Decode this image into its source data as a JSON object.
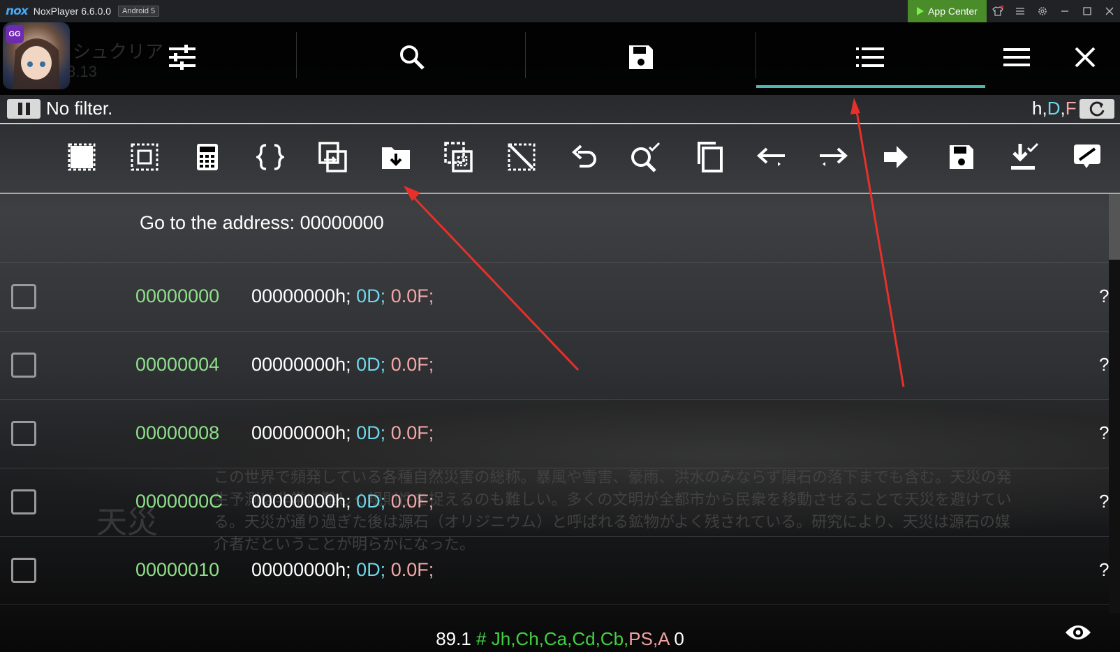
{
  "titlebar": {
    "logo": "nox",
    "title": "NoxPlayer 6.6.0.0",
    "android_badge": "Android 5",
    "app_center": "App Center",
    "icons": [
      "shirt-icon",
      "menu-icon",
      "gear-icon",
      "minimize-icon",
      "maximize-icon",
      "close-icon"
    ]
  },
  "gg_toolbar": {
    "avatar_badge": "GG",
    "ghost_title": "シュクリア",
    "ghost_version": "8.13",
    "tabs": [
      "settings-sliders-icon",
      "search-icon",
      "save-icon",
      "list-icon"
    ],
    "active_tab": "list-icon",
    "right_icons": [
      "hamburger-icon",
      "close-icon"
    ],
    "accent": "#4fb6b0"
  },
  "filter": {
    "text": "No filter.",
    "type_h": "h",
    "sep1": ",",
    "type_d": "D",
    "sep2": ",",
    "type_f": "F"
  },
  "actions": [
    "select-all-icon",
    "select-range-icon",
    "calculator-icon",
    "braces-icon",
    "copy-range-icon",
    "folder-download-icon",
    "copy-dashed-icon",
    "deselect-icon",
    "undo-icon",
    "search-check-icon",
    "copy-icon",
    "arrow-left-icon",
    "arrow-right-icon",
    "arrow-solid-right-icon",
    "save-icon",
    "download-check-icon",
    "edit-check-icon"
  ],
  "goto_label": "Go to the address: 00000000",
  "rows": [
    {
      "addr": "00000000",
      "hex": "00000000h;",
      "dec": "0D;",
      "float": "0.0F;",
      "q": "?"
    },
    {
      "addr": "00000004",
      "hex": "00000000h;",
      "dec": "0D;",
      "float": "0.0F;",
      "q": "?"
    },
    {
      "addr": "00000008",
      "hex": "00000000h;",
      "dec": "0D;",
      "float": "0.0F;",
      "q": "?"
    },
    {
      "addr": "0000000C",
      "hex": "00000000h;",
      "dec": "0D;",
      "float": "0.0F;",
      "q": "?"
    },
    {
      "addr": "00000010",
      "hex": "00000000h;",
      "dec": "0D;",
      "float": "0.0F;",
      "q": "?"
    }
  ],
  "background_text": {
    "heading": "天災",
    "body": "この世界で頻発している各種自然災害の総称。暴風や雪害、豪雨、洪水のみならず隕石の落下までも含む。天災の発生予測は非常に難しく規則性を捉えるのも難しい。多くの文明が全都市から民衆を移動させることで天災を避けている。天災が通り過ぎた後は源石（オリジニウム）と呼ばれる鉱物がよく残されている。研究により、天災は源石の媒介者だということが明らかになった。"
  },
  "status": {
    "prefix": "89.1",
    "hash": "#",
    "regs": "Jh,Ch,Ca,Cd,Cb,",
    "regs2": "PS,A",
    "suffix": "0"
  },
  "colors": {
    "address": "#8ee08a",
    "dword": "#6fd7ec",
    "float": "#f4a8a8",
    "annotation_arrow": "#e8302a"
  }
}
